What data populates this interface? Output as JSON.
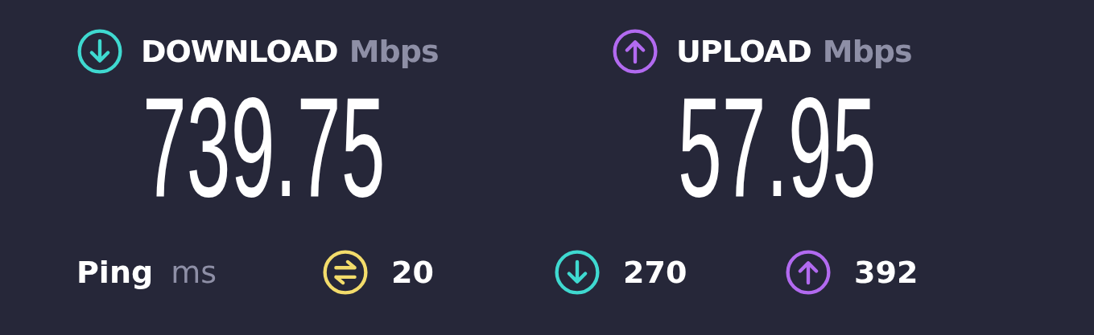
{
  "results": [
    {
      "kind": "download",
      "label": "DOWNLOAD",
      "unit": "Mbps",
      "value": "739.75"
    },
    {
      "kind": "upload",
      "label": "UPLOAD",
      "unit": "Mbps",
      "value": "57.95"
    }
  ],
  "ping": {
    "label": "Ping",
    "unit": "ms"
  },
  "ping_stats": [
    {
      "kind": "ping",
      "value": "20"
    },
    {
      "kind": "download",
      "value": "270"
    },
    {
      "kind": "upload",
      "value": "392"
    }
  ]
}
